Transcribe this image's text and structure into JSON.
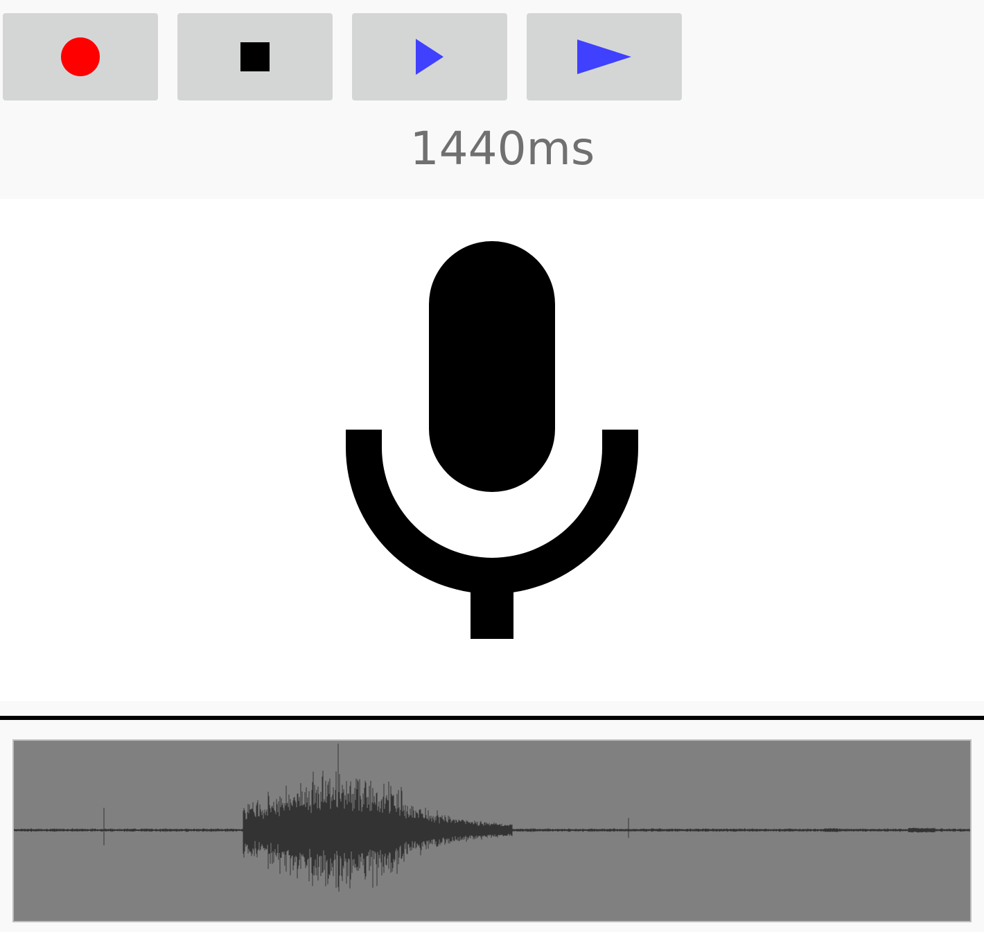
{
  "app": {
    "title": ""
  },
  "toolbar": {
    "buttons": [
      {
        "name": "record",
        "icon": "record-icon",
        "color": "#ff0000"
      },
      {
        "name": "stop",
        "icon": "stop-icon",
        "color": "#000000"
      },
      {
        "name": "play",
        "icon": "play-icon",
        "color": "#4040ff"
      },
      {
        "name": "play-fast",
        "icon": "play-wide-icon",
        "color": "#4040ff"
      }
    ],
    "duration_text": "1440ms"
  },
  "mic": {
    "icon": "microphone-icon",
    "color": "#000000"
  },
  "waveform": {
    "background": "#808080",
    "trace_color": "#333333",
    "duration_ms": 1440
  }
}
